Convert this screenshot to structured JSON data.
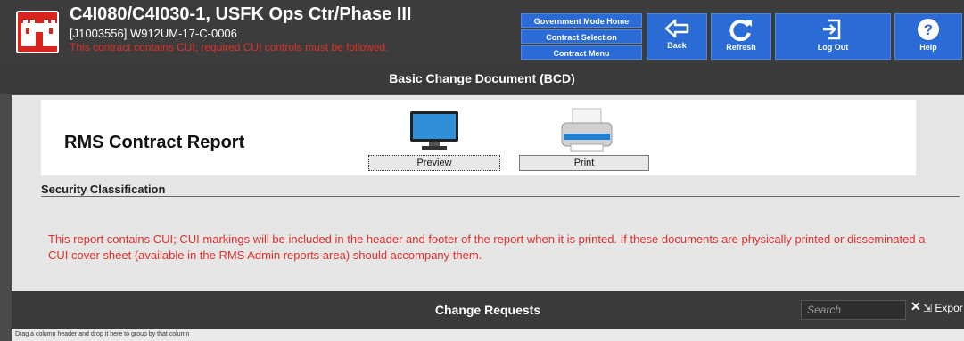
{
  "header": {
    "title": "C4I080/C4I030-1, USFK Ops Ctr/Phase III",
    "subtitle": "[J1003556] W912UM-17-C-0006",
    "cui_warning": "This contract contains CUI; required CUI controls must be followed."
  },
  "nav_menu": [
    "Government Mode Home",
    "Contract Selection",
    "Contract Menu"
  ],
  "toolbar": {
    "back": "Back",
    "refresh": "Refresh",
    "logout": "Log Out",
    "help": "Help"
  },
  "section_bar": "Basic Change Document (BCD)",
  "report": {
    "title": "RMS Contract Report",
    "preview_label": "Preview",
    "print_label": "Print"
  },
  "security": {
    "title": "Security Classification",
    "cui_text": "This report contains CUI; CUI markings will be included in the header and footer of the report when it is printed. If these documents are physically printed or disseminated a CUI cover sheet (available in the RMS Admin reports area) should accompany them."
  },
  "change_requests": {
    "title": "Change Requests",
    "search_placeholder": "Search",
    "export_label": "Expor",
    "group_hint": "Drag a column header and drop it here to group by that column"
  },
  "colors": {
    "accent": "#2a6bd6",
    "warning": "#e0302a",
    "logo": "#d8231f"
  }
}
